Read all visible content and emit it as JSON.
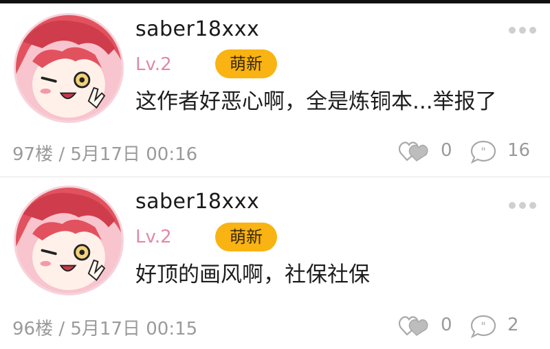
{
  "colors": {
    "level": "#e089a8",
    "badge_bg": "#f9b312",
    "meta": "#9a9a9a",
    "avatar_hair": "#e2525e",
    "avatar_bg": "#f8c4cd"
  },
  "icons": {
    "more": "more-dots-icon",
    "like": "heart-like-icon",
    "reply": "quote-reply-icon"
  },
  "comments": [
    {
      "username": "saber18xxx",
      "level": "Lv.2",
      "badge": "萌新",
      "content": "这作者好恶心啊，全是炼铜本...举报了",
      "floor_time": "97楼 / 5月17日 00:16",
      "likes": "0",
      "replies": "16"
    },
    {
      "username": "saber18xxx",
      "level": "Lv.2",
      "badge": "萌新",
      "content": "好顶的画风啊，社保社保",
      "floor_time": "96楼 / 5月17日 00:15",
      "likes": "0",
      "replies": "2"
    }
  ]
}
